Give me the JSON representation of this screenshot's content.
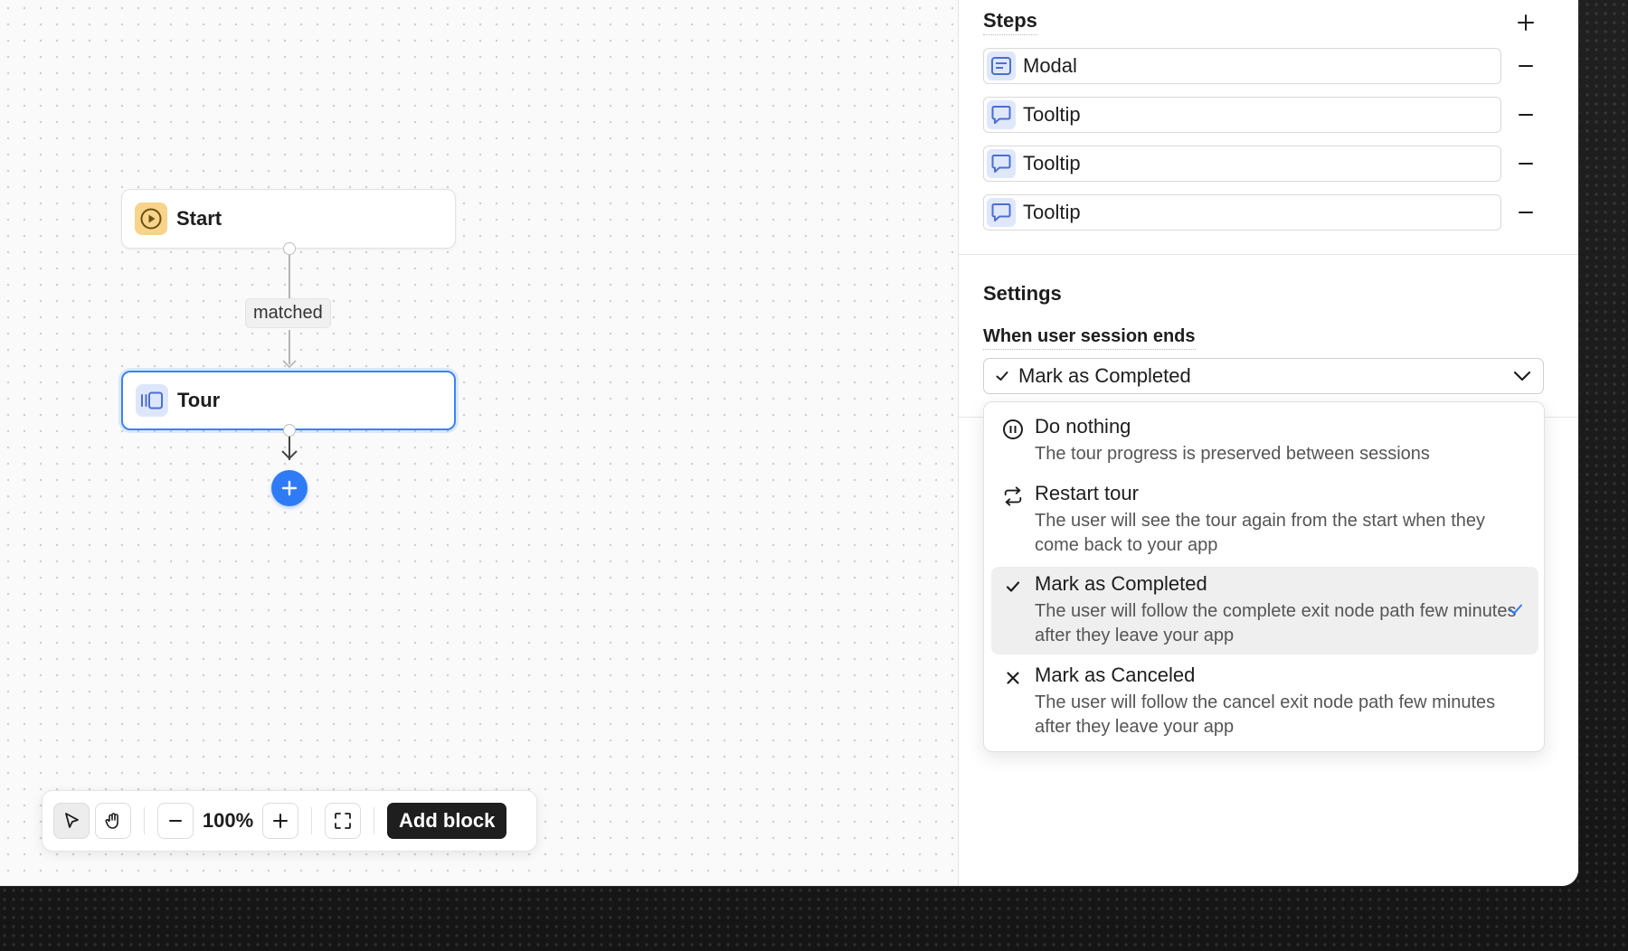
{
  "canvas": {
    "nodes": {
      "start": {
        "label": "Start",
        "icon": "play-circle-icon"
      },
      "tour": {
        "label": "Tour",
        "icon": "tour-carousel-icon"
      }
    },
    "edge_label": "matched"
  },
  "toolbar": {
    "zoom": "100%",
    "add_block_label": "Add block"
  },
  "steps": {
    "title": "Steps",
    "items": [
      {
        "label": "Modal",
        "icon": "modal-icon"
      },
      {
        "label": "Tooltip",
        "icon": "tooltip-icon"
      },
      {
        "label": "Tooltip",
        "icon": "tooltip-icon"
      },
      {
        "label": "Tooltip",
        "icon": "tooltip-icon"
      }
    ]
  },
  "settings": {
    "title": "Settings",
    "session_end_label": "When user session ends",
    "selected_value": "Mark as Completed",
    "options": [
      {
        "title": "Do nothing",
        "description": "The tour progress is preserved between sessions",
        "icon": "pause-circle-icon"
      },
      {
        "title": "Restart tour",
        "description": "The user will see the tour again from the start when they come back to your app",
        "icon": "repeat-icon"
      },
      {
        "title": "Mark as Completed",
        "description": "The user will follow the complete exit node path few minutes after they leave your app",
        "icon": "check-icon",
        "selected": true
      },
      {
        "title": "Mark as Canceled",
        "description": "The user will follow the cancel exit node path few minutes after they leave your app",
        "icon": "x-icon"
      }
    ]
  },
  "colors": {
    "accent": "#2f7bf5",
    "selected_node_border": "#3b82f6",
    "start_icon_bg": "#f7d48a",
    "step_icon_bg": "#dfe7fb"
  }
}
